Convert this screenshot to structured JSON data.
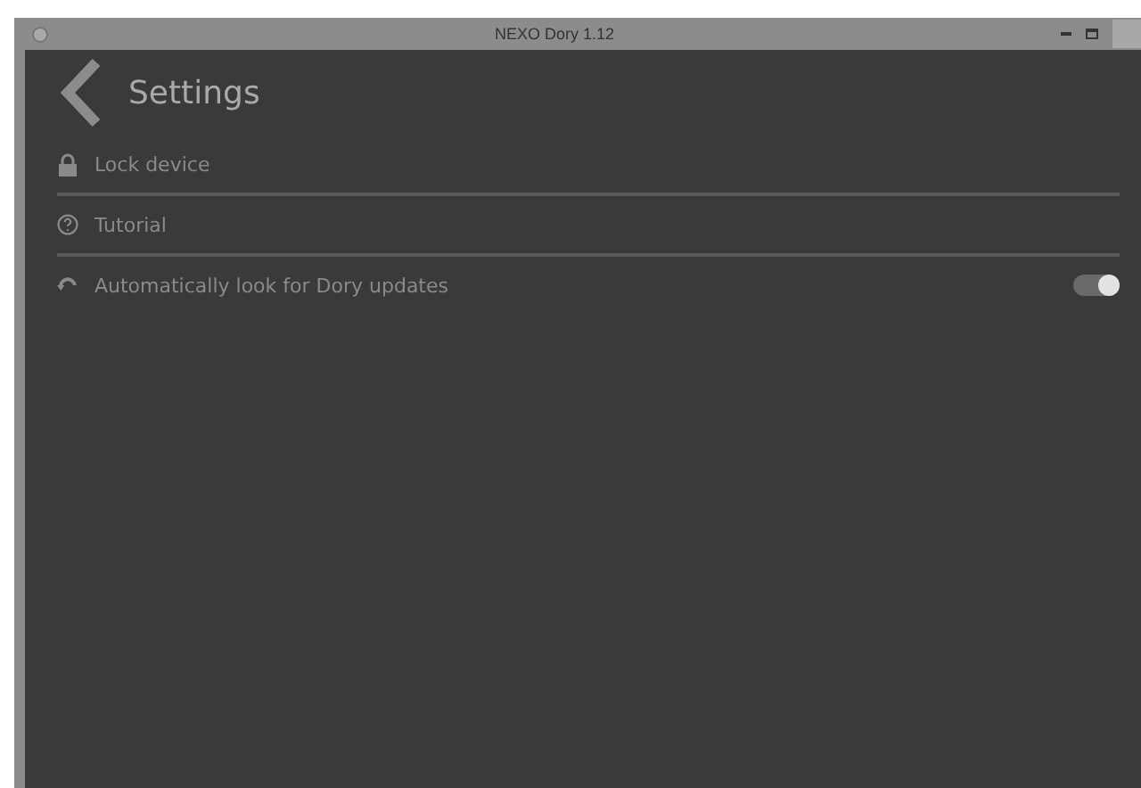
{
  "window": {
    "title": "NEXO Dory 1.12"
  },
  "header": {
    "title": "Settings"
  },
  "items": [
    {
      "kind": "lock",
      "label": "Lock device"
    },
    {
      "kind": "help",
      "label": "Tutorial"
    },
    {
      "kind": "toggle",
      "label": "Automatically look for Dory updates",
      "on": true
    }
  ]
}
